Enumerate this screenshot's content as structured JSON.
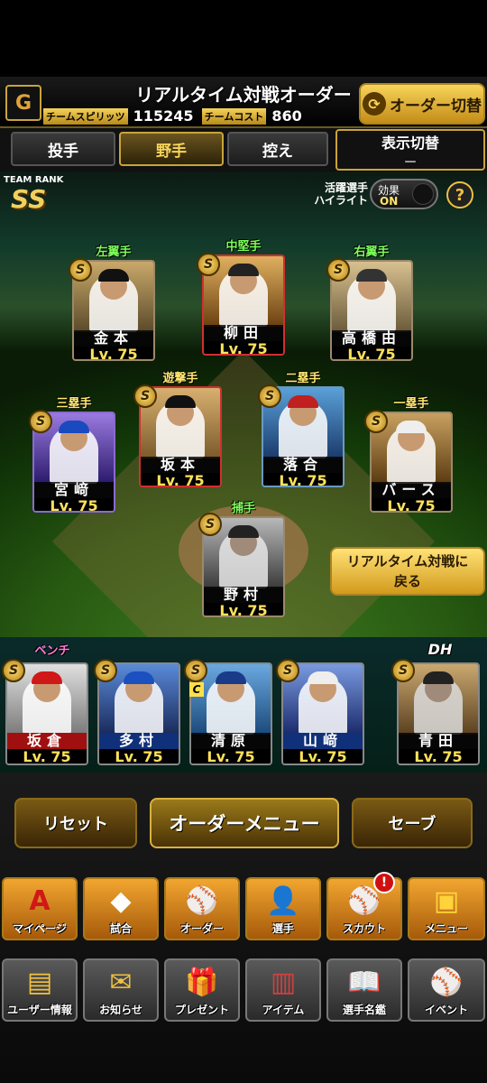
{
  "header": {
    "title": "リアルタイム対戦オーダー",
    "team_spirits_label": "チームスピリッツ",
    "team_spirits_value": "115245",
    "team_cost_label": "チームコスト",
    "team_cost_value": "860",
    "order_switch_label": "オーダー切替"
  },
  "tabs": [
    {
      "label": "投手"
    },
    {
      "label": "野手"
    },
    {
      "label": "控え"
    }
  ],
  "display_switch": {
    "title": "表示切替",
    "value": "－"
  },
  "team_rank": {
    "label": "TEAM RANK",
    "value": "SS"
  },
  "highlight": {
    "label_line1": "活躍選手",
    "label_line2": "ハイライト",
    "effect_label": "効果",
    "effect_state": "ON"
  },
  "help_label": "?",
  "lineup": [
    {
      "position": "左翼手",
      "name": "金本",
      "level": "Lv. 75",
      "badge": "S"
    },
    {
      "position": "中堅手",
      "name": "柳田",
      "level": "Lv. 75",
      "badge": "S"
    },
    {
      "position": "右翼手",
      "name": "高橋由",
      "level": "Lv. 75",
      "badge": "S"
    },
    {
      "position": "遊撃手",
      "name": "坂本",
      "level": "Lv. 75",
      "badge": "S"
    },
    {
      "position": "二塁手",
      "name": "落合",
      "level": "Lv. 75",
      "badge": "S"
    },
    {
      "position": "三塁手",
      "name": "宮﨑",
      "level": "Lv. 75",
      "badge": "S"
    },
    {
      "position": "一塁手",
      "name": "バース",
      "level": "Lv. 75",
      "badge": "S"
    },
    {
      "position": "捕手",
      "name": "野村",
      "level": "Lv. 75",
      "badge": "S"
    }
  ],
  "back_button": {
    "line1": "リアルタイム対戦に",
    "line2": "戻る"
  },
  "bench": {
    "label": "ベンチ",
    "dh_label": "DH",
    "captain_mark": "C",
    "players": [
      {
        "name": "坂倉",
        "level": "Lv. 75",
        "badge": "S"
      },
      {
        "name": "多村",
        "level": "Lv. 75",
        "badge": "S"
      },
      {
        "name": "清原",
        "level": "Lv. 75",
        "badge": "S"
      },
      {
        "name": "山﨑",
        "level": "Lv. 75",
        "badge": "S"
      },
      {
        "name": "青田",
        "level": "Lv. 75",
        "badge": "S"
      }
    ]
  },
  "actions": {
    "reset": "リセット",
    "order_menu": "オーダーメニュー",
    "save": "セーブ"
  },
  "nav_row1": [
    {
      "label": "マイページ",
      "icon": "A"
    },
    {
      "label": "試合",
      "icon": "◆"
    },
    {
      "label": "オーダー",
      "icon": "⚾"
    },
    {
      "label": "選手",
      "icon": "👤"
    },
    {
      "label": "スカウト",
      "icon": "⚾"
    },
    {
      "label": "メニュー",
      "icon": "▣"
    }
  ],
  "nav_row2": [
    {
      "label": "ユーザー情報",
      "icon": "▤"
    },
    {
      "label": "お知らせ",
      "icon": "✉"
    },
    {
      "label": "プレゼント",
      "icon": "🎁"
    },
    {
      "label": "アイテム",
      "icon": "▥"
    },
    {
      "label": "選手名鑑",
      "icon": "📖"
    },
    {
      "label": "イベント",
      "icon": "⚾"
    }
  ],
  "notification_mark": "!",
  "colors": {
    "accent_gold": "#f0c040",
    "outfield_pos": "#7dff5a",
    "infield_pos": "#ffe870",
    "bench_pos": "#ff7ad9"
  }
}
